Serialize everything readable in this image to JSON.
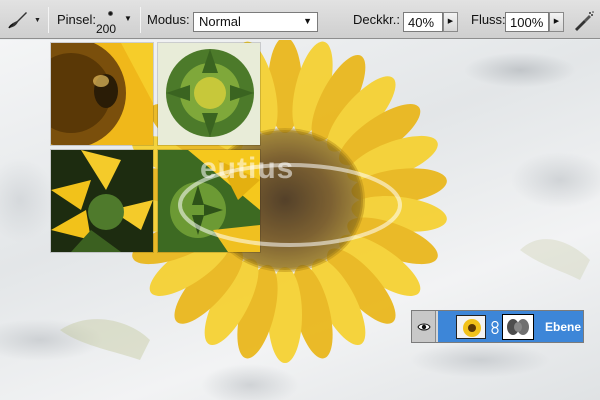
{
  "options_bar": {
    "tool_icon": "brush-tool-icon",
    "brush_label": "Pinsel:",
    "brush_size": "200",
    "mode_label": "Modus:",
    "mode_value": "Normal",
    "opacity_label": "Deckkr.:",
    "opacity_value": "40%",
    "flow_label": "Fluss:",
    "flow_value": "100%",
    "airbrush_icon": "airbrush-icon"
  },
  "canvas": {
    "watermark_text": "eutius"
  },
  "layer": {
    "visibility_icon": "eye-icon",
    "link_icon": "chain-link-icon",
    "name": "Ebene"
  },
  "colors": {
    "selection": "#3d86d8",
    "sunflower_petal": "#f2c21a",
    "sunflower_center": "#6b4a12"
  }
}
